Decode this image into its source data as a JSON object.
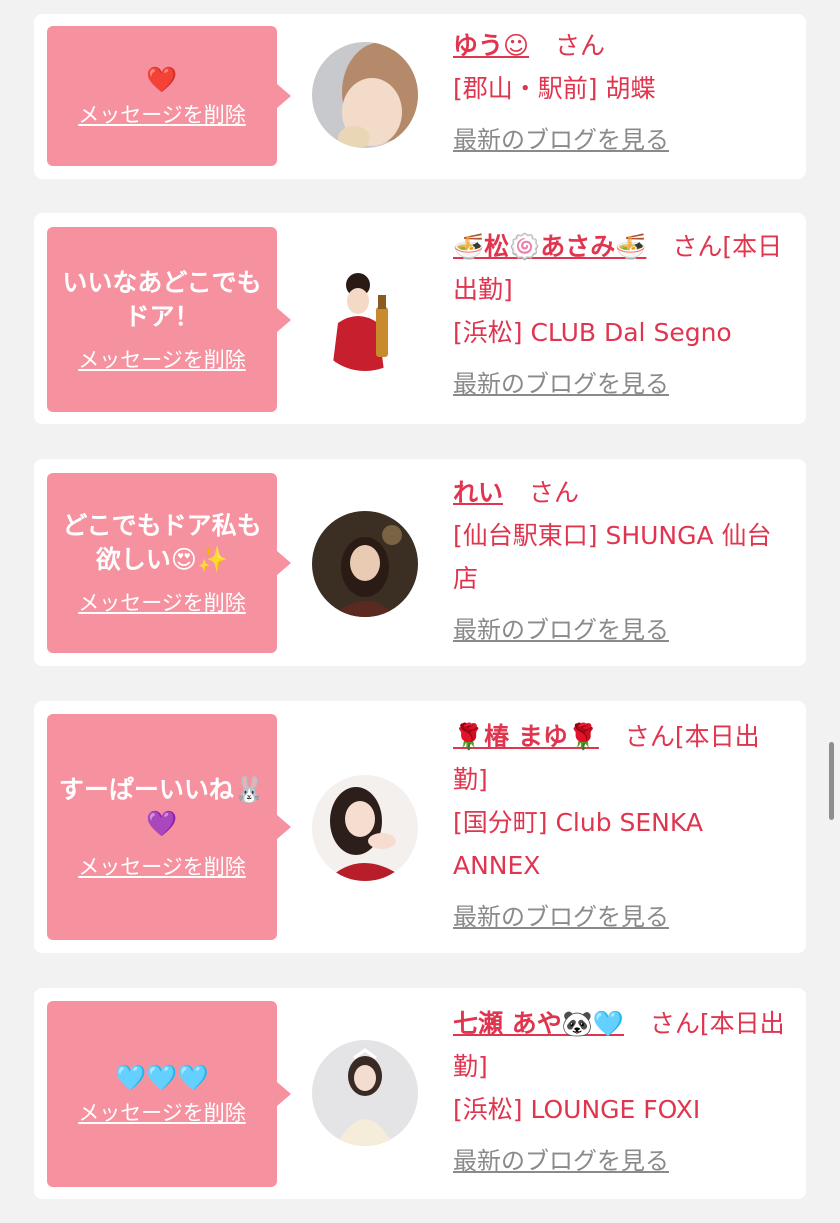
{
  "messages": [
    {
      "bubble_text": "❤️",
      "delete_label": "メッセージを削除",
      "name": "ゆう☺︎",
      "san": "さん",
      "store_line": "[郡山・駅前] 胡蝶",
      "blog_link": "最新のブログを見る"
    },
    {
      "bubble_text": "いいなあどこでも\nドア！",
      "delete_label": "メッセージを削除",
      "name": "🍜松🍥あさみ🍜",
      "san": "さん[本日出勤]",
      "store_line": "[浜松] CLUB Dal Segno",
      "blog_link": "最新のブログを見る"
    },
    {
      "bubble_text": "どこでもドア私も\n欲しい😍✨",
      "delete_label": "メッセージを削除",
      "name": "れい",
      "san": "さん",
      "store_line": "[仙台駅東口] SHUNGA 仙台店",
      "blog_link": "最新のブログを見る"
    },
    {
      "bubble_text": "すーぱーいいね🐰\n💜",
      "delete_label": "メッセージを削除",
      "name": "🌹椿 まゆ🌹",
      "san": "さん[本日出勤]",
      "store_line": "[国分町] Club SENKA ANNEX",
      "blog_link": "最新のブログを見る"
    },
    {
      "bubble_text": "🩵🩵🩵",
      "delete_label": "メッセージを削除",
      "name": "七瀬 あや🐼🩵",
      "san": "さん[本日出勤]",
      "store_line": "[浜松] LOUNGE FOXI",
      "blog_link": "最新のブログを見る"
    }
  ],
  "colors": {
    "accent": "#e0354f",
    "bubble": "#f6919f",
    "link_gray": "#8a8a8a",
    "background": "#f2f2f2"
  },
  "avatars": [
    "avatar-photo",
    "avatar-photo",
    "avatar-photo",
    "avatar-photo",
    "avatar-photo"
  ]
}
